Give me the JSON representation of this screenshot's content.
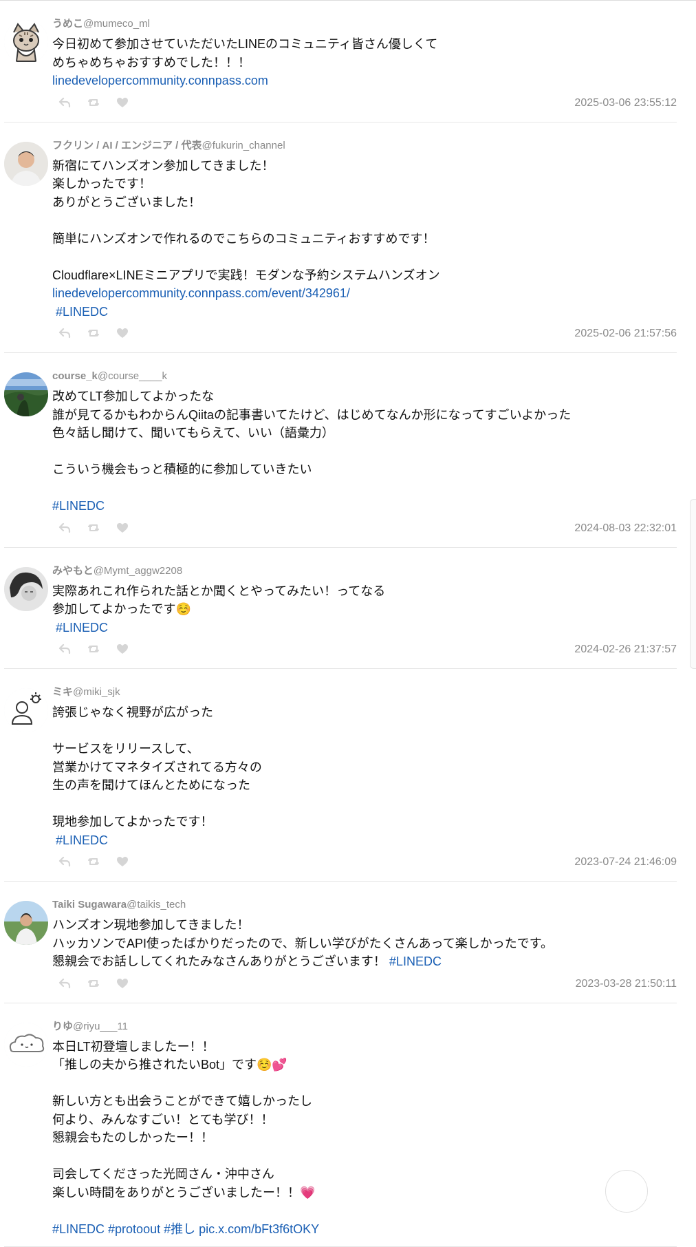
{
  "tweets": [
    {
      "display_name": "うめこ",
      "handle": "@mumeco_ml",
      "avatar_icon": "cat-avatar-icon",
      "body": [
        {
          "t": "今日初めて参加させていただいたLINEのコミュニティ皆さん優しくて\nめちゃめちゃおすすめでした！！！\n"
        },
        {
          "t": "linedevelopercommunity.connpass.com",
          "link": true
        }
      ],
      "timestamp": "2025-03-06 23:55:12"
    },
    {
      "display_name": "フクリン / AI / エンジニア / 代表",
      "handle": "@fukurin_channel",
      "avatar_icon": "person-photo-avatar-icon",
      "body": [
        {
          "t": "新宿にてハンズオン参加してきました！\n楽しかったです！\nありがとうございました！\n\n簡単にハンズオンで作れるのでこちらのコミュニティおすすめです！\n\nCloudflare×LINEミニアプリで実践！モダンな予約システムハンズオン\n"
        },
        {
          "t": "linedevelopercommunity.connpass.com/event/342961/",
          "link": true
        },
        {
          "t": "\n "
        },
        {
          "t": "#LINEDC",
          "link": true
        }
      ],
      "timestamp": "2025-02-06 21:57:56"
    },
    {
      "display_name": "course_k",
      "handle": "@course____k",
      "avatar_icon": "landscape-avatar-icon",
      "body": [
        {
          "t": "改めてLT参加してよかったな\n誰が見てるかもわからんQiitaの記事書いてたけど、はじめてなんか形になってすごいよかった\n色々話し聞けて、聞いてもらえて、いい（語彙力）\n\nこういう機会もっと積極的に参加していきたい\n\n"
        },
        {
          "t": "#LINEDC",
          "link": true
        }
      ],
      "timestamp": "2024-08-03 22:32:01"
    },
    {
      "display_name": "みやもと",
      "handle": "@Mymt_aggw2208",
      "avatar_icon": "sketch-avatar-icon",
      "body": [
        {
          "t": "実際あれこれ作られた話とか聞くとやってみたい！ってなる\n参加してよかったです☺️\n "
        },
        {
          "t": "#LINEDC",
          "link": true
        }
      ],
      "timestamp": "2024-02-26 21:37:57"
    },
    {
      "display_name": "ミキ",
      "handle": "@miki_sjk",
      "avatar_icon": "person-idea-avatar-icon",
      "body": [
        {
          "t": "誇張じゃなく視野が広がった\n\nサービスをリリースして、\n営業かけてマネタイズされてる方々の\n生の声を聞けてほんとためになった\n\n現地参加してよかったです！\n "
        },
        {
          "t": "#LINEDC",
          "link": true
        }
      ],
      "timestamp": "2023-07-24 21:46:09"
    },
    {
      "display_name": "Taiki Sugawara",
      "handle": "@taikis_tech",
      "avatar_icon": "outdoor-person-avatar-icon",
      "body": [
        {
          "t": "ハンズオン現地参加してきました！\nハッカソンでAPI使ったばかりだったので、新しい学びがたくさんあって楽しかったです。\n懇親会でお話ししてくれたみなさんありがとうございます！ "
        },
        {
          "t": "#LINEDC",
          "link": true
        }
      ],
      "timestamp": "2023-03-28 21:50:11"
    },
    {
      "display_name": "りゆ",
      "handle": "@riyu___11",
      "avatar_icon": "cloud-face-avatar-icon",
      "body": [
        {
          "t": "本日LT初登壇しましたー！！\n「推しの夫から推されたいBot」です☺️💕\n\n新しい方とも出会うことができて嬉しかったし\n何より、みんなすごい！とても学び！！\n懇親会もたのしかったー！！\n\n司会してくださった光岡さん・沖中さん\n楽しい時間をありがとうございましたー！！💗\n\n"
        },
        {
          "t": "#LINEDC #protoout #推し pic.x.com/bFt3f6tOKY",
          "link": true
        }
      ],
      "timestamp": ""
    }
  ],
  "colors": {
    "link": "#1a5fb4",
    "meta": "#8b8b8b",
    "divider": "#e6e6e6"
  }
}
